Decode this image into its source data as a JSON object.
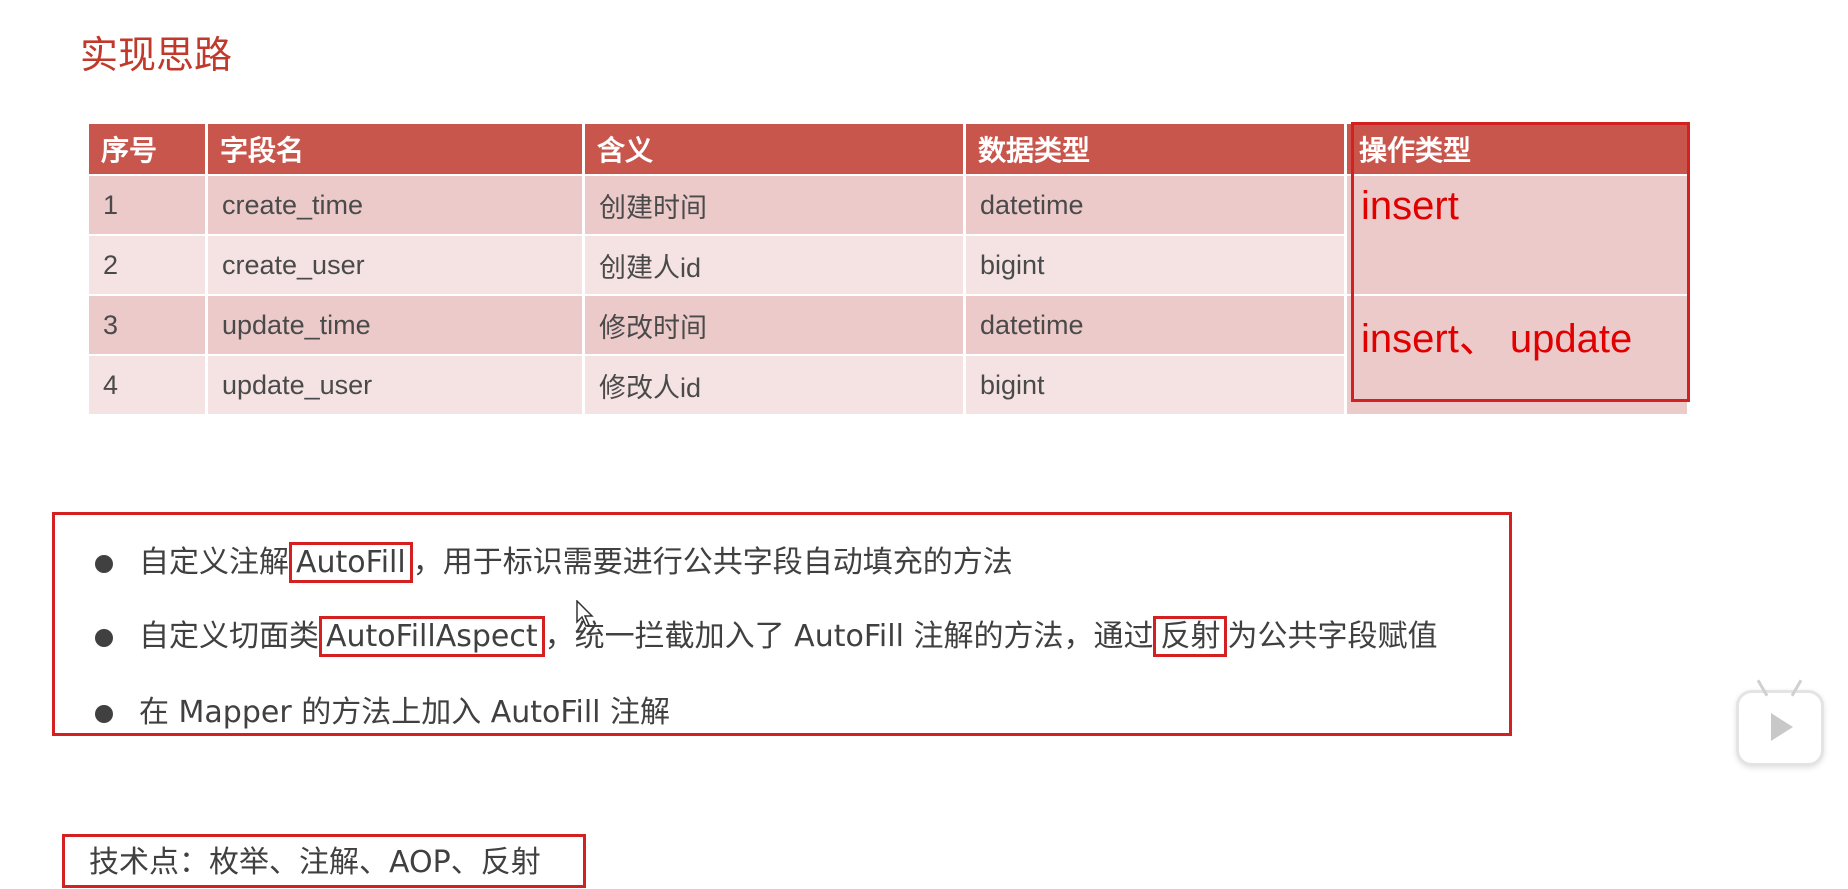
{
  "title": "实现思路",
  "table": {
    "headers": [
      "序号",
      "字段名",
      "含义",
      "数据类型",
      "操作类型"
    ],
    "rows": [
      {
        "no": "1",
        "field": "create_time",
        "meaning": "创建时间",
        "type": "datetime"
      },
      {
        "no": "2",
        "field": "create_user",
        "meaning": "创建人id",
        "type": "bigint"
      },
      {
        "no": "3",
        "field": "update_time",
        "meaning": "修改时间",
        "type": "datetime"
      },
      {
        "no": "4",
        "field": "update_user",
        "meaning": "修改人id",
        "type": "bigint"
      }
    ],
    "ops": [
      "insert",
      "insert、 update"
    ]
  },
  "notes": {
    "n1": {
      "pre": "自定义注解",
      "hl": "AutoFill",
      "post": "，用于标识需要进行公共字段自动填充的方法"
    },
    "n2": {
      "pre": "自定义切面类",
      "hl": "AutoFillAspect",
      "mid": "，统一拦截加入了 AutoFill 注解的方法，通过",
      "hl2": "反射",
      "post": "为公共字段赋值"
    },
    "n3": {
      "text": "在 Mapper 的方法上加入 AutoFill 注解"
    }
  },
  "tech": "技术点：枚举、注解、AOP、反射",
  "colors": {
    "accent": "#c0392b",
    "header_bg": "#c9564d",
    "highlight_border": "#d32020",
    "op_text": "#e00000"
  },
  "icons": {
    "player": "play-icon",
    "cursor": "mouse-cursor-icon"
  }
}
